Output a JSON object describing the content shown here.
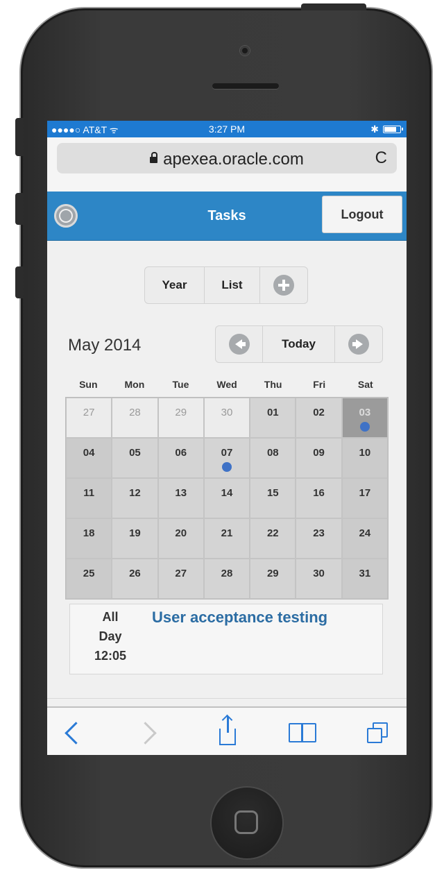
{
  "status_bar": {
    "carrier": "●●●●○ AT&T",
    "wifi": "ᯤ",
    "time": "3:27 PM",
    "bluetooth": "✱",
    "battery_percent": 90
  },
  "browser": {
    "url": "apexea.oracle.com",
    "reload_icon": "C"
  },
  "header": {
    "title": "Tasks",
    "logout_label": "Logout",
    "menu_icon": "menu-circle-icon"
  },
  "view_buttons": {
    "year": "Year",
    "list": "List",
    "add_icon": "plus-circle-icon"
  },
  "calendar": {
    "month_label": "May 2014",
    "today_label": "Today",
    "days_of_week": [
      "Sun",
      "Mon",
      "Tue",
      "Wed",
      "Thu",
      "Fri",
      "Sat"
    ],
    "weeks": [
      [
        {
          "d": "27",
          "other": true
        },
        {
          "d": "28",
          "other": true
        },
        {
          "d": "29",
          "other": true
        },
        {
          "d": "30",
          "other": true
        },
        {
          "d": "01"
        },
        {
          "d": "02"
        },
        {
          "d": "03",
          "selected": true,
          "event": true
        }
      ],
      [
        {
          "d": "04"
        },
        {
          "d": "05"
        },
        {
          "d": "06"
        },
        {
          "d": "07",
          "event": true
        },
        {
          "d": "08"
        },
        {
          "d": "09"
        },
        {
          "d": "10"
        }
      ],
      [
        {
          "d": "11"
        },
        {
          "d": "12"
        },
        {
          "d": "13"
        },
        {
          "d": "14"
        },
        {
          "d": "15"
        },
        {
          "d": "16"
        },
        {
          "d": "17"
        }
      ],
      [
        {
          "d": "18"
        },
        {
          "d": "19"
        },
        {
          "d": "20"
        },
        {
          "d": "21"
        },
        {
          "d": "22"
        },
        {
          "d": "23"
        },
        {
          "d": "24"
        }
      ],
      [
        {
          "d": "25"
        },
        {
          "d": "26"
        },
        {
          "d": "27"
        },
        {
          "d": "28"
        },
        {
          "d": "29"
        },
        {
          "d": "30"
        },
        {
          "d": "31"
        }
      ]
    ]
  },
  "event": {
    "time_lines": [
      "All",
      "Day",
      "12:05"
    ],
    "title": "User acceptance testing"
  },
  "colors": {
    "status_bar": "#1e7ad1",
    "header": "#2d86c6",
    "event_dot": "#3f72c6",
    "toolbar_accent": "#2a7ad6"
  }
}
